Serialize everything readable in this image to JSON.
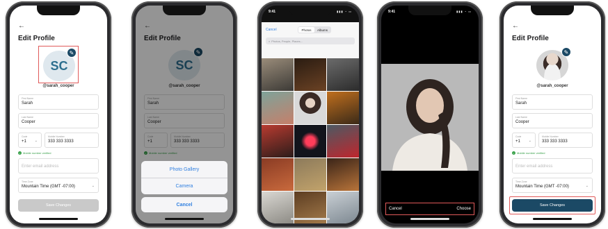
{
  "screen1": {
    "title": "Edit Profile",
    "avatar_initials": "SC",
    "username": "@sarah_cooper",
    "first_name_label": "First Name",
    "first_name": "Sarah",
    "last_name_label": "Last Name",
    "last_name": "Cooper",
    "code_label": "Code",
    "country_code": "+1",
    "mobile_label": "Mobile Number",
    "mobile": "333 333 3333",
    "verified_text": "Mobile number verified",
    "email_placeholder": "Enter email address",
    "timezone_label": "Time Zone",
    "timezone": "Mountain Time (GMT -07:00)",
    "save_label": "Save Changes"
  },
  "screen2": {
    "title": "Edit Profile",
    "avatar_initials": "SC",
    "username": "@sarah_cooper",
    "first_name_label": "First Name",
    "first_name": "Sarah",
    "last_name_label": "Last Name",
    "last_name": "Cooper",
    "code_label": "Code",
    "country_code": "+1",
    "mobile_label": "Mobile Number",
    "mobile": "333 333 3333",
    "verified_text": "Mobile number verified",
    "sheet_option_1": "Photo Gallery",
    "sheet_option_2": "Camera",
    "sheet_cancel": "Cancel"
  },
  "screen3": {
    "time": "9:41",
    "cancel_label": "Cancel",
    "tab_photos": "Photos",
    "tab_albums": "Albums",
    "search_placeholder": "Photos, People, Places..."
  },
  "screen4": {
    "time": "9:41",
    "cancel_label": "Cancel",
    "choose_label": "Choose"
  },
  "screen5": {
    "title": "Edit Profile",
    "username": "@sarah_cooper",
    "first_name_label": "First Name",
    "first_name": "Sarah",
    "last_name_label": "Last Name",
    "last_name": "Cooper",
    "code_label": "Code",
    "country_code": "+1",
    "mobile_label": "Mobile Number",
    "mobile": "333 333 3333",
    "verified_text": "Mobile number verified",
    "email_placeholder": "Enter email address",
    "timezone_label": "Time Zone",
    "timezone": "Mountain Time (GMT -07:00)",
    "save_label": "Save Changes"
  },
  "colors": {
    "primary": "#1b4965",
    "highlight": "#e05a5a",
    "verified": "#39a14a",
    "link": "#2f7fe0",
    "disabled": "#c9c9c9"
  }
}
